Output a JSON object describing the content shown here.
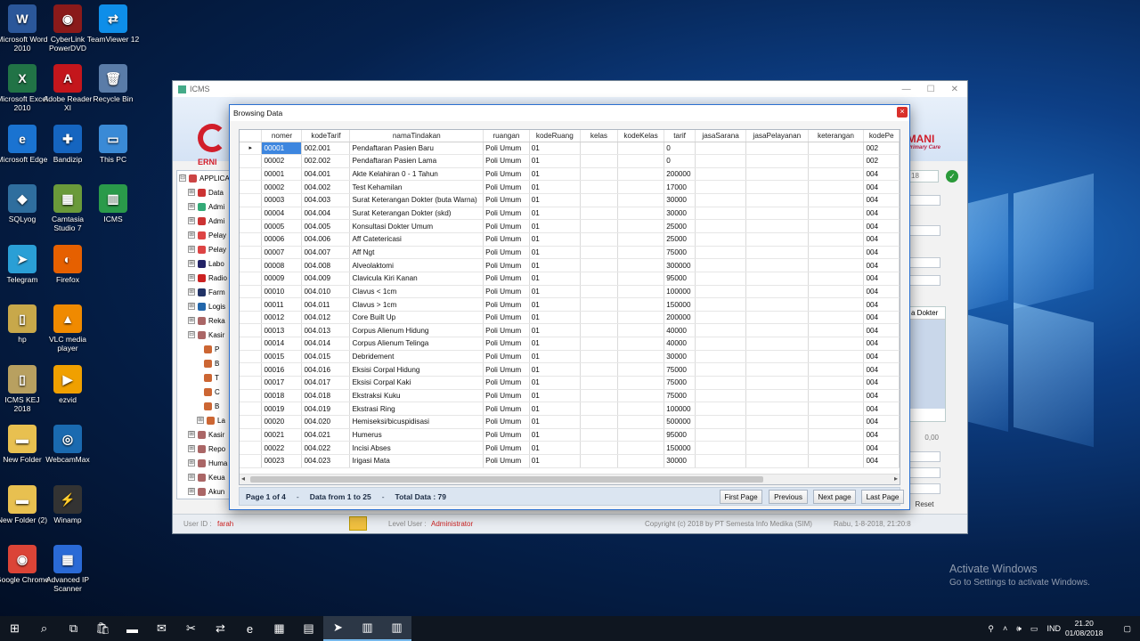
{
  "desktop": {
    "icons": [
      {
        "label": "Microsoft Word 2010",
        "glyph": "W",
        "color": "#2b579a"
      },
      {
        "label": "CyberLink PowerDVD",
        "glyph": "◉",
        "color": "#8a1a1a"
      },
      {
        "label": "TeamViewer 12",
        "glyph": "⇄",
        "color": "#0e8ee9"
      },
      {
        "label": "Microsoft Excel 2010",
        "glyph": "X",
        "color": "#217346"
      },
      {
        "label": "Adobe Reader XI",
        "glyph": "A",
        "color": "#c4161c"
      },
      {
        "label": "Recycle Bin",
        "glyph": "🗑",
        "color": "#5a7ca8"
      },
      {
        "label": "Microsoft Edge",
        "glyph": "e",
        "color": "#1a73d1"
      },
      {
        "label": "Bandizip",
        "glyph": "✚",
        "color": "#1565c0"
      },
      {
        "label": "This PC",
        "glyph": "▭",
        "color": "#3a8ad6"
      },
      {
        "label": "SQLyog",
        "glyph": "◆",
        "color": "#2f6e9e"
      },
      {
        "label": "Camtasia Studio 7",
        "glyph": "▦",
        "color": "#6a9a3a"
      },
      {
        "label": "ICMS",
        "glyph": "▥",
        "color": "#2a9a4a"
      },
      {
        "label": "Telegram",
        "glyph": "➤",
        "color": "#2a9fd6"
      },
      {
        "label": "Firefox",
        "glyph": "◐",
        "color": "#e66000"
      },
      {
        "label": "hp",
        "glyph": "▯",
        "color": "#c8a84a"
      },
      {
        "label": "VLC media player",
        "glyph": "▲",
        "color": "#f08a00"
      },
      {
        "label": "ICMS KEJ 2018",
        "glyph": "▯",
        "color": "#b8a060"
      },
      {
        "label": "ezvid",
        "glyph": "▶",
        "color": "#f0a000"
      },
      {
        "label": "New Folder",
        "glyph": "▬",
        "color": "#e8c050"
      },
      {
        "label": "WebcamMax",
        "glyph": "◎",
        "color": "#1a6ab0"
      },
      {
        "label": "New Folder (2)",
        "glyph": "▬",
        "color": "#e8c050"
      },
      {
        "label": "Winamp",
        "glyph": "⚡",
        "color": "#333"
      },
      {
        "label": "Google Chrome",
        "glyph": "◉",
        "color": "#db4437"
      },
      {
        "label": "Advanced IP Scanner",
        "glyph": "▦",
        "color": "#2a6ad6"
      }
    ]
  },
  "icms_window": {
    "title": "ICMS",
    "logo_left": "ERNI",
    "logo_right": "MANI",
    "logo_right_sub": "Primary Care",
    "tree": [
      {
        "label": "APPLICA",
        "exp": "⊟",
        "color": "#c44"
      },
      {
        "label": "Data",
        "exp": "⊞",
        "color": "#c33"
      },
      {
        "label": "Admi",
        "exp": "⊞",
        "color": "#3a7"
      },
      {
        "label": "Admi",
        "exp": "⊞",
        "color": "#c33"
      },
      {
        "label": "Pelay",
        "exp": "⊞",
        "color": "#d44"
      },
      {
        "label": "Pelay",
        "exp": "⊞",
        "color": "#d44"
      },
      {
        "label": "Labo",
        "exp": "⊞",
        "color": "#226"
      },
      {
        "label": "Radio",
        "exp": "⊞",
        "color": "#c22"
      },
      {
        "label": "Farm",
        "exp": "⊞",
        "color": "#236"
      },
      {
        "label": "Logis",
        "exp": "⊞",
        "color": "#26a"
      },
      {
        "label": "Reka",
        "exp": "⊞",
        "color": "#a66"
      },
      {
        "label": "Kasir",
        "exp": "⊟",
        "color": "#a66"
      },
      {
        "label": "P",
        "exp": "",
        "color": "#c63"
      },
      {
        "label": "B",
        "exp": "",
        "color": "#c63"
      },
      {
        "label": "T",
        "exp": "",
        "color": "#c63"
      },
      {
        "label": "C",
        "exp": "",
        "color": "#c63"
      },
      {
        "label": "B",
        "exp": "",
        "color": "#c63"
      },
      {
        "label": "La",
        "exp": "⊞",
        "color": "#c63"
      },
      {
        "label": "Kasir",
        "exp": "⊞",
        "color": "#a66"
      },
      {
        "label": "Repo",
        "exp": "⊞",
        "color": "#a66"
      },
      {
        "label": "Huma",
        "exp": "⊞",
        "color": "#a66"
      },
      {
        "label": "Keua",
        "exp": "⊞",
        "color": "#a66"
      },
      {
        "label": "Akun",
        "exp": "⊞",
        "color": "#a66"
      }
    ],
    "side_date": "18",
    "side_dokter": "a Dokter",
    "side_amount": "0,00",
    "side_reset": "Reset",
    "user_id_label": "User ID :",
    "user_id_value": "farah",
    "level_label": "Level User :",
    "level_value": "Administrator",
    "copyright": "Copyright (c) 2018 by PT Semesta Info Medika (SIM)",
    "date_status": "Rabu, 1-8-2018, 21:20:8"
  },
  "dialog": {
    "title": "Browsing Data",
    "close": "×",
    "columns": [
      "nomer",
      "kodeTarif",
      "namaTindakan",
      "ruangan",
      "kodeRuang",
      "kelas",
      "kodeKelas",
      "tarif",
      "jasaSarana",
      "jasaPelayanan",
      "keterangan",
      "kodePe"
    ],
    "rows": [
      [
        "00001",
        "002.001",
        "Pendaftaran Pasien Baru",
        "Poli Umum",
        "01",
        "",
        "",
        "0",
        "",
        "",
        "",
        "002"
      ],
      [
        "00002",
        "002.002",
        "Pendaftaran Pasien Lama",
        "Poli Umum",
        "01",
        "",
        "",
        "0",
        "",
        "",
        "",
        "002"
      ],
      [
        "00001",
        "004.001",
        "Akte Kelahiran 0 - 1 Tahun",
        "Poli Umum",
        "01",
        "",
        "",
        "200000",
        "",
        "",
        "",
        "004"
      ],
      [
        "00002",
        "004.002",
        "Test Kehamilan",
        "Poli Umum",
        "01",
        "",
        "",
        "17000",
        "",
        "",
        "",
        "004"
      ],
      [
        "00003",
        "004.003",
        "Surat Keterangan Dokter (buta Warna)",
        "Poli Umum",
        "01",
        "",
        "",
        "30000",
        "",
        "",
        "",
        "004"
      ],
      [
        "00004",
        "004.004",
        "Surat Keterangan Dokter (skd)",
        "Poli Umum",
        "01",
        "",
        "",
        "30000",
        "",
        "",
        "",
        "004"
      ],
      [
        "00005",
        "004.005",
        "Konsultasi Dokter Umum",
        "Poli Umum",
        "01",
        "",
        "",
        "25000",
        "",
        "",
        "",
        "004"
      ],
      [
        "00006",
        "004.006",
        "Aff Catetericasi",
        "Poli Umum",
        "01",
        "",
        "",
        "25000",
        "",
        "",
        "",
        "004"
      ],
      [
        "00007",
        "004.007",
        "Aff Ngt",
        "Poli Umum",
        "01",
        "",
        "",
        "75000",
        "",
        "",
        "",
        "004"
      ],
      [
        "00008",
        "004.008",
        "Alveolaktomi",
        "Poli Umum",
        "01",
        "",
        "",
        "300000",
        "",
        "",
        "",
        "004"
      ],
      [
        "00009",
        "004.009",
        "Clavicula Kiri Kanan",
        "Poli Umum",
        "01",
        "",
        "",
        "95000",
        "",
        "",
        "",
        "004"
      ],
      [
        "00010",
        "004.010",
        "Clavus < 1cm",
        "Poli Umum",
        "01",
        "",
        "",
        "100000",
        "",
        "",
        "",
        "004"
      ],
      [
        "00011",
        "004.011",
        "Clavus > 1cm",
        "Poli Umum",
        "01",
        "",
        "",
        "150000",
        "",
        "",
        "",
        "004"
      ],
      [
        "00012",
        "004.012",
        "Core Built Up",
        "Poli Umum",
        "01",
        "",
        "",
        "200000",
        "",
        "",
        "",
        "004"
      ],
      [
        "00013",
        "004.013",
        "Corpus Alienum Hidung",
        "Poli Umum",
        "01",
        "",
        "",
        "40000",
        "",
        "",
        "",
        "004"
      ],
      [
        "00014",
        "004.014",
        "Corpus Alienum Telinga",
        "Poli Umum",
        "01",
        "",
        "",
        "40000",
        "",
        "",
        "",
        "004"
      ],
      [
        "00015",
        "004.015",
        "Debridement",
        "Poli Umum",
        "01",
        "",
        "",
        "30000",
        "",
        "",
        "",
        "004"
      ],
      [
        "00016",
        "004.016",
        "Eksisi Corpal Hidung",
        "Poli Umum",
        "01",
        "",
        "",
        "75000",
        "",
        "",
        "",
        "004"
      ],
      [
        "00017",
        "004.017",
        "Eksisi Corpal Kaki",
        "Poli Umum",
        "01",
        "",
        "",
        "75000",
        "",
        "",
        "",
        "004"
      ],
      [
        "00018",
        "004.018",
        "Ekstraksi Kuku",
        "Poli Umum",
        "01",
        "",
        "",
        "75000",
        "",
        "",
        "",
        "004"
      ],
      [
        "00019",
        "004.019",
        "Ekstrasi Ring",
        "Poli Umum",
        "01",
        "",
        "",
        "100000",
        "",
        "",
        "",
        "004"
      ],
      [
        "00020",
        "004.020",
        "Hemiseksi/bicuspidisasi",
        "Poli Umum",
        "01",
        "",
        "",
        "500000",
        "",
        "",
        "",
        "004"
      ],
      [
        "00021",
        "004.021",
        "Humerus",
        "Poli Umum",
        "01",
        "",
        "",
        "95000",
        "",
        "",
        "",
        "004"
      ],
      [
        "00022",
        "004.022",
        "Incisi Abses",
        "Poli Umum",
        "01",
        "",
        "",
        "150000",
        "",
        "",
        "",
        "004"
      ],
      [
        "00023",
        "004.023",
        "Irigasi Mata",
        "Poli Umum",
        "01",
        "",
        "",
        "30000",
        "",
        "",
        "",
        "004"
      ]
    ],
    "selected_row": 0,
    "row_indicator": "▸",
    "pager": {
      "page_text": "Page 1 of 4",
      "data_from": "Data from 1 to 25",
      "total": "Total Data : 79",
      "separator": "-",
      "first": "First Page",
      "previous": "Previous",
      "next": "Next page",
      "last": "Last Page"
    }
  },
  "watermark": {
    "line1": "Activate Windows",
    "line2": "Go to Settings to activate Windows."
  },
  "taskbar": {
    "buttons": [
      "⊞",
      "⌕",
      "⧉",
      "🛍",
      "▬",
      "✉",
      "✂",
      "⇄",
      "e",
      "▦",
      "▤",
      "➤",
      "▥",
      "▥"
    ],
    "tray": {
      "lang": "IND",
      "time": "21.20",
      "date": "01/08/2018"
    }
  }
}
